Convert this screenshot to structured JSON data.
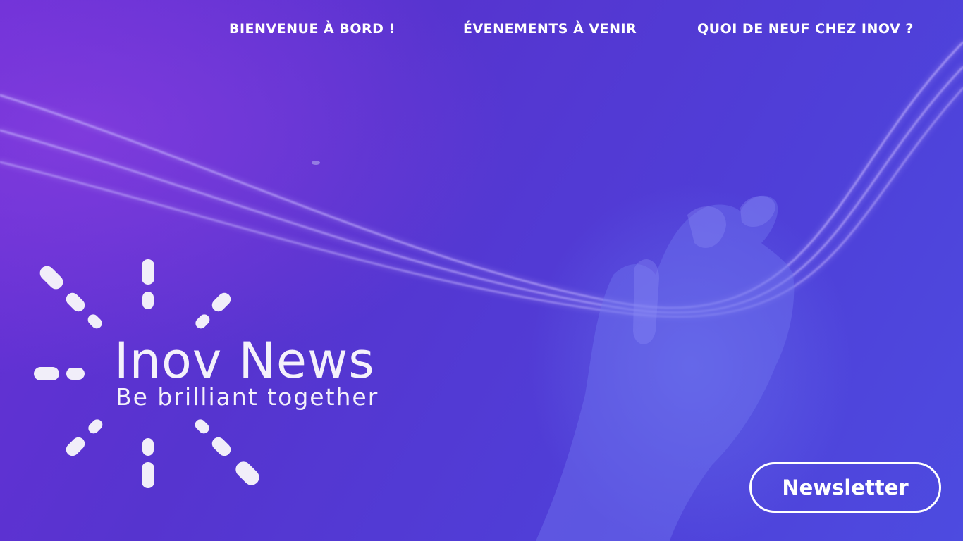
{
  "nav": {
    "items": [
      {
        "label": "BIENVENUE À BORD !"
      },
      {
        "label": "ÉVENEMENTS À VENIR"
      },
      {
        "label": "QUOI DE NEUF CHEZ INOV ?"
      }
    ]
  },
  "brand": {
    "title": "Inov News",
    "tagline": "Be brilliant together",
    "logo_icon": "sunburst-icon"
  },
  "hero": {
    "image": "hand-holding-light-strands"
  },
  "cta": {
    "newsletter_label": "Newsletter"
  },
  "colors": {
    "background_start": "#6a2fd6",
    "background_end": "#4d4be0",
    "text": "#ffffff"
  }
}
